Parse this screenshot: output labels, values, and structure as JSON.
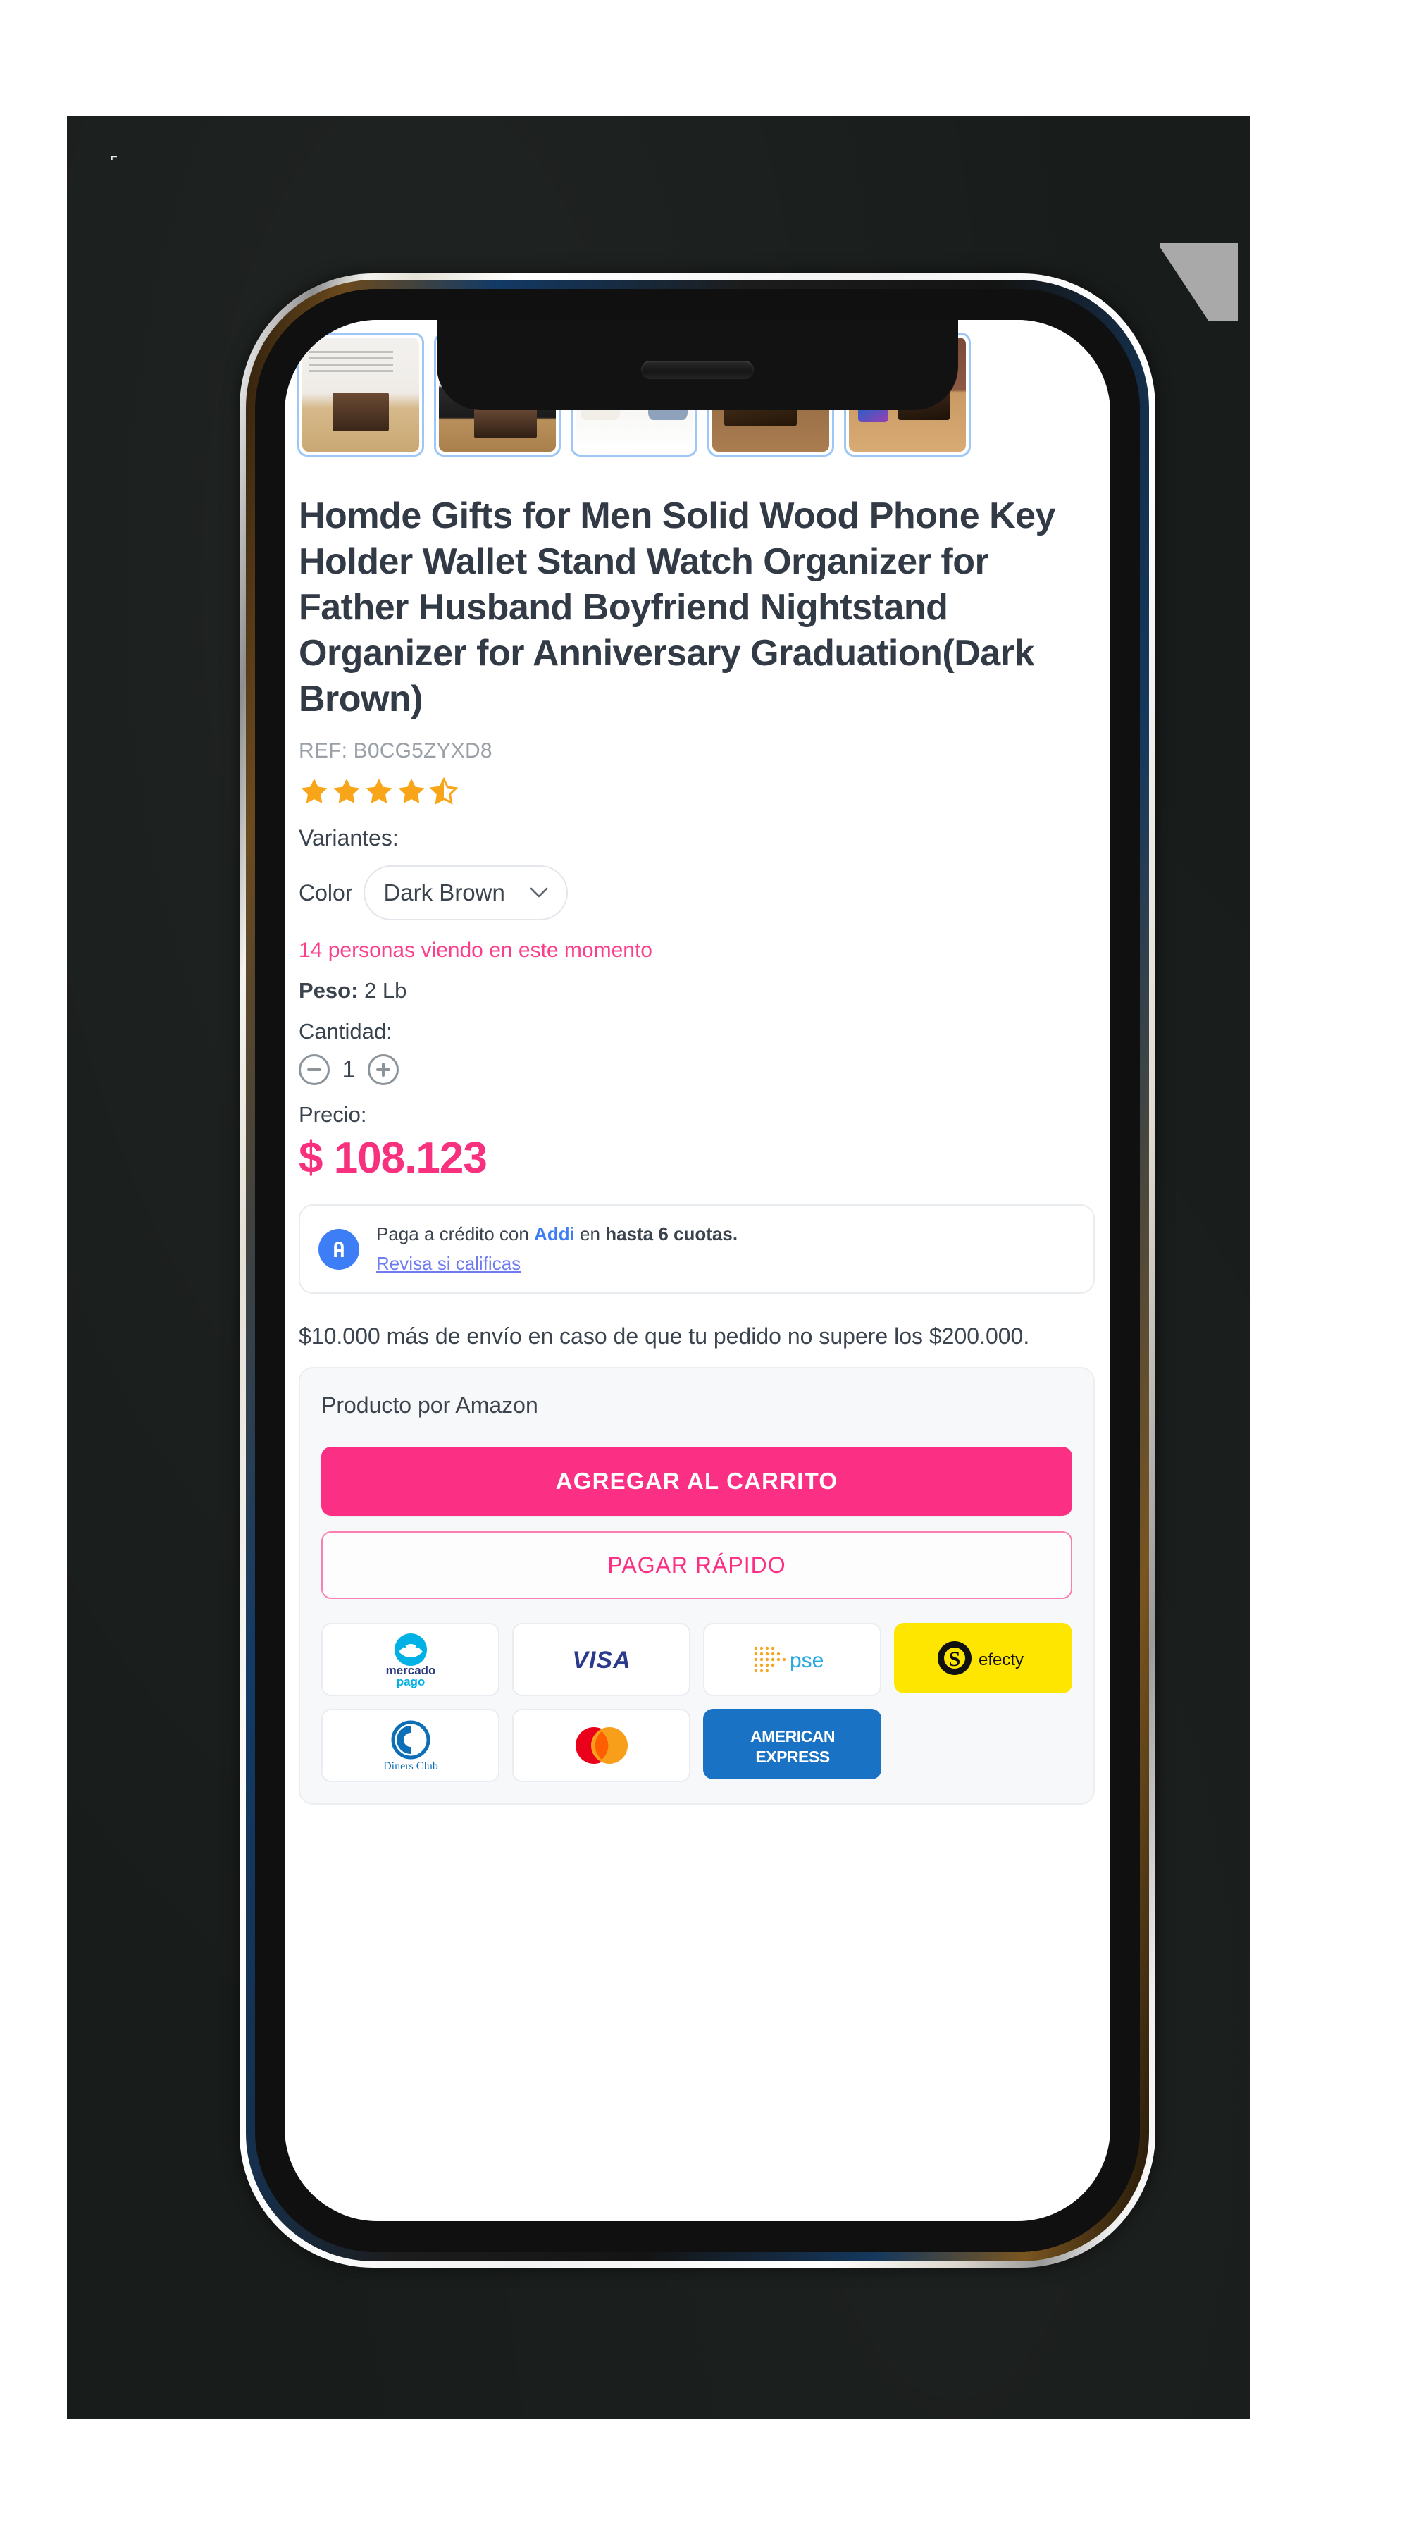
{
  "device": {
    "type": "smartphone-mockup",
    "backdrop_color": "#181c1a",
    "frame_color": "#ffffff"
  },
  "product": {
    "title": "Homde Gifts for Men Solid Wood Phone Key Holder Wallet Stand Watch Organizer for Father Husband Boyfriend Nightstand Organizer for Anniversary Graduation(Dark Brown)",
    "ref_label": "REF: B0CG5ZYXD8",
    "rating": 4.5,
    "rating_max": 5,
    "star_color": "#f9a51a",
    "thumbnails": [
      {
        "alt": "product-on-nightstand"
      },
      {
        "alt": "product-detail-collage"
      },
      {
        "alt": "couple-gifting-product"
      },
      {
        "alt": "product-holiday-scene"
      },
      {
        "alt": "product-with-phone-brick-wall"
      }
    ]
  },
  "variants": {
    "heading": "Variantes:",
    "color_label": "Color",
    "color_value": "Dark Brown",
    "color_options": [
      "Dark Brown"
    ]
  },
  "urgency": {
    "viewers_text": "14 personas viendo en este momento",
    "viewers_color": "#fb3f8b"
  },
  "specs": {
    "weight_label": "Peso:",
    "weight_value": "2 Lb"
  },
  "quantity": {
    "label": "Cantidad:",
    "value": "1",
    "decrease_icon": "minus-circle-icon",
    "increase_icon": "plus-circle-icon"
  },
  "price": {
    "label": "Precio:",
    "value": "$ 108.123",
    "color": "#f8317f"
  },
  "addi": {
    "icon": "addi-logo-icon",
    "text_before": "Paga a crédito con ",
    "brand": "Addi",
    "text_middle": " en ",
    "text_bold": "hasta 6 cuotas.",
    "link": "Revisa si calificas",
    "brand_color": "#3d7df6",
    "link_color": "#6f7cf0"
  },
  "shipping": {
    "note": "$10.000 más de envío en caso de que tu pedido no supere los $200.000."
  },
  "purchase": {
    "seller": "Producto por Amazon",
    "add_to_cart": "AGREGAR AL CARRITO",
    "fast_checkout": "PAGAR RÁPIDO",
    "add_to_cart_color": "#fb2f83",
    "fast_checkout_color": "#fb2f83"
  },
  "payment_methods": [
    {
      "name": "mercado-pago",
      "label": "mercado pago"
    },
    {
      "name": "visa",
      "label": "VISA"
    },
    {
      "name": "pse",
      "label": "pse"
    },
    {
      "name": "efecty",
      "label": "efecty"
    },
    {
      "name": "diners-club",
      "label": "Diners Club"
    },
    {
      "name": "mastercard",
      "label": "Mastercard"
    },
    {
      "name": "american-express",
      "label": "AMERICAN EXPRESS"
    },
    {
      "name": "empty-slot",
      "label": ""
    }
  ]
}
